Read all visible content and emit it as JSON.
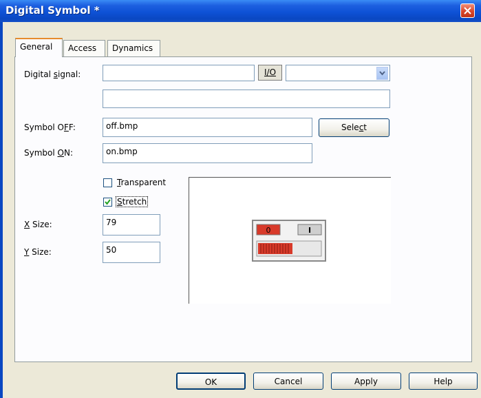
{
  "window": {
    "title": "Digital Symbol *"
  },
  "tabs": [
    {
      "label": "General",
      "active": true
    },
    {
      "label": "Access",
      "active": false
    },
    {
      "label": "Dynamics",
      "active": false
    }
  ],
  "form": {
    "digital_signal": {
      "label_pre": "Digital ",
      "label_key": "s",
      "label_post": "ignal:",
      "value": "",
      "io_button": "I/O",
      "combo_value": "",
      "description_value": ""
    },
    "symbol_off": {
      "label_pre": "Symbol O",
      "label_key": "F",
      "label_post": "F:",
      "value": "off.bmp",
      "select_pre": "Sele",
      "select_key": "c",
      "select_post": "t"
    },
    "symbol_on": {
      "label_pre": "Symbol ",
      "label_key": "O",
      "label_post": "N:",
      "value": "on.bmp"
    },
    "transparent": {
      "label_key": "T",
      "label_post": "ransparent",
      "checked": false
    },
    "stretch": {
      "label_key": "S",
      "label_post": "tretch",
      "checked": true
    },
    "x_size": {
      "label_key": "X",
      "label_post": " Size:",
      "value": "79"
    },
    "y_size": {
      "label_key": "Y",
      "label_post": " Size:",
      "value": "50"
    }
  },
  "preview": {
    "off_label": "0",
    "on_label": "I",
    "colors": {
      "red": "#d83a2a",
      "frame": "#888888"
    }
  },
  "buttons": {
    "ok": "OK",
    "cancel": "Cancel",
    "apply": "Apply",
    "help": "Help"
  },
  "colors": {
    "titlebar": "#0a47c2",
    "dialog_bg": "#ece9d8",
    "tab_accent": "#e68b2c"
  }
}
